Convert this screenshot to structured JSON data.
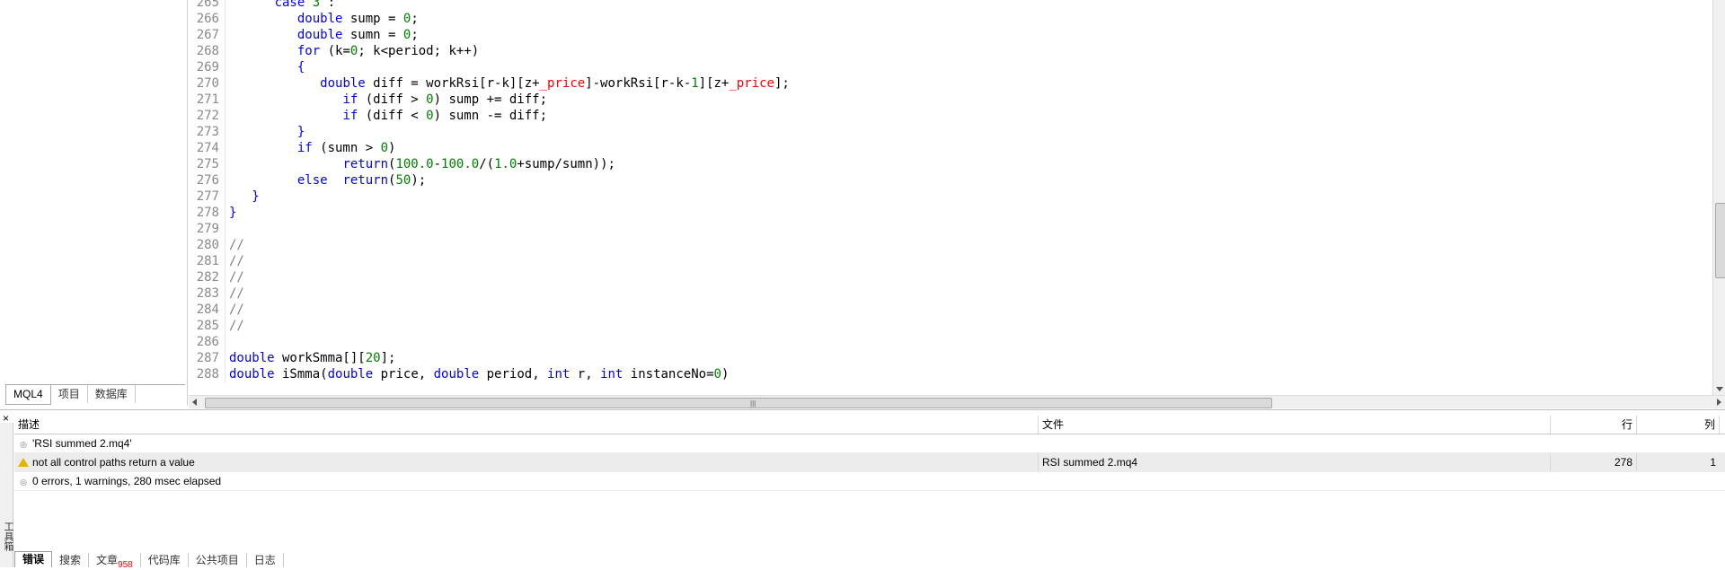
{
  "navigator": {
    "tabs": [
      "MQL4",
      "项目",
      "数据库"
    ]
  },
  "editor": {
    "lines": [
      {
        "n": "265",
        "parts": [
          [
            "ct",
            "      "
          ],
          [
            "kw",
            "case"
          ],
          [
            "ct",
            " "
          ],
          [
            "num",
            "3"
          ],
          [
            "ct",
            " :"
          ]
        ]
      },
      {
        "n": "266",
        "parts": [
          [
            "ct",
            "         "
          ],
          [
            "tp",
            "double"
          ],
          [
            "ct",
            " sump = "
          ],
          [
            "num",
            "0"
          ],
          [
            "ct",
            ";"
          ]
        ]
      },
      {
        "n": "267",
        "parts": [
          [
            "ct",
            "         "
          ],
          [
            "tp",
            "double"
          ],
          [
            "ct",
            " sumn = "
          ],
          [
            "num",
            "0"
          ],
          [
            "ct",
            ";"
          ]
        ]
      },
      {
        "n": "268",
        "parts": [
          [
            "ct",
            "         "
          ],
          [
            "kw",
            "for"
          ],
          [
            "ct",
            " (k="
          ],
          [
            "num",
            "0"
          ],
          [
            "ct",
            "; k<period; k++)"
          ]
        ]
      },
      {
        "n": "269",
        "parts": [
          [
            "ct",
            "         "
          ],
          [
            "kw",
            "{"
          ]
        ]
      },
      {
        "n": "270",
        "parts": [
          [
            "ct",
            "            "
          ],
          [
            "tp",
            "double"
          ],
          [
            "ct",
            " diff = workRsi[r-k][z+"
          ],
          [
            "var",
            "_price"
          ],
          [
            "ct",
            "]-workRsi[r-k-"
          ],
          [
            "num",
            "1"
          ],
          [
            "ct",
            "][z+"
          ],
          [
            "var",
            "_price"
          ],
          [
            "ct",
            "];"
          ]
        ]
      },
      {
        "n": "271",
        "parts": [
          [
            "ct",
            "               "
          ],
          [
            "kw",
            "if"
          ],
          [
            "ct",
            " (diff > "
          ],
          [
            "num",
            "0"
          ],
          [
            "ct",
            ") sump += diff;"
          ]
        ]
      },
      {
        "n": "272",
        "parts": [
          [
            "ct",
            "               "
          ],
          [
            "kw",
            "if"
          ],
          [
            "ct",
            " (diff < "
          ],
          [
            "num",
            "0"
          ],
          [
            "ct",
            ") sumn -= diff;"
          ]
        ]
      },
      {
        "n": "273",
        "parts": [
          [
            "ct",
            "         "
          ],
          [
            "kw",
            "}"
          ]
        ]
      },
      {
        "n": "274",
        "parts": [
          [
            "ct",
            "         "
          ],
          [
            "kw",
            "if"
          ],
          [
            "ct",
            " (sumn > "
          ],
          [
            "num",
            "0"
          ],
          [
            "ct",
            ")"
          ]
        ]
      },
      {
        "n": "275",
        "parts": [
          [
            "ct",
            "               "
          ],
          [
            "kw",
            "return"
          ],
          [
            "ct",
            "("
          ],
          [
            "num",
            "100.0"
          ],
          [
            "ct",
            "-"
          ],
          [
            "num",
            "100.0"
          ],
          [
            "ct",
            "/("
          ],
          [
            "num",
            "1.0"
          ],
          [
            "ct",
            "+sump/sumn));"
          ]
        ]
      },
      {
        "n": "276",
        "parts": [
          [
            "ct",
            "         "
          ],
          [
            "kw",
            "else"
          ],
          [
            "ct",
            "  "
          ],
          [
            "kw",
            "return"
          ],
          [
            "ct",
            "("
          ],
          [
            "num",
            "50"
          ],
          [
            "ct",
            ");"
          ]
        ]
      },
      {
        "n": "277",
        "parts": [
          [
            "ct",
            "   "
          ],
          [
            "kw",
            "}"
          ]
        ]
      },
      {
        "n": "278",
        "parts": [
          [
            "kw",
            "}"
          ]
        ]
      },
      {
        "n": "279",
        "parts": []
      },
      {
        "n": "280",
        "parts": [
          [
            "cm",
            "//"
          ]
        ]
      },
      {
        "n": "281",
        "parts": [
          [
            "cm",
            "//"
          ]
        ]
      },
      {
        "n": "282",
        "parts": [
          [
            "cm",
            "//"
          ]
        ]
      },
      {
        "n": "283",
        "parts": [
          [
            "cm",
            "//"
          ]
        ]
      },
      {
        "n": "284",
        "parts": [
          [
            "cm",
            "//"
          ]
        ]
      },
      {
        "n": "285",
        "parts": [
          [
            "cm",
            "//"
          ]
        ]
      },
      {
        "n": "286",
        "parts": []
      },
      {
        "n": "287",
        "parts": [
          [
            "tp",
            "double"
          ],
          [
            "ct",
            " workSmma[]["
          ],
          [
            "num",
            "20"
          ],
          [
            "ct",
            "];"
          ]
        ]
      },
      {
        "n": "288",
        "parts": [
          [
            "tp",
            "double"
          ],
          [
            "ct",
            " iSmma("
          ],
          [
            "tp",
            "double"
          ],
          [
            "ct",
            " price, "
          ],
          [
            "tp",
            "double"
          ],
          [
            "ct",
            " period, "
          ],
          [
            "tp",
            "int"
          ],
          [
            "ct",
            " r, "
          ],
          [
            "tp",
            "int"
          ],
          [
            "ct",
            " instanceNo="
          ],
          [
            "num",
            "0"
          ],
          [
            "ct",
            ")"
          ]
        ]
      }
    ]
  },
  "toolbox": {
    "close_glyph": "×",
    "side_label": "工具箱",
    "columns": {
      "desc": "描述",
      "file": "文件",
      "line": "行",
      "col": "列"
    },
    "rows": [
      {
        "icon": "info",
        "desc": "'RSI summed 2.mq4'",
        "file": "",
        "line": "",
        "col": "",
        "selected": false
      },
      {
        "icon": "warning",
        "desc": "not all control paths return a value",
        "file": "RSI summed 2.mq4",
        "line": "278",
        "col": "1",
        "selected": true
      },
      {
        "icon": "info",
        "desc": "0 errors, 1 warnings, 280 msec elapsed",
        "file": "",
        "line": "",
        "col": "",
        "selected": false
      }
    ],
    "tabs": [
      {
        "label": "错误",
        "badge": ""
      },
      {
        "label": "搜索",
        "badge": ""
      },
      {
        "label": "文章",
        "badge": "958"
      },
      {
        "label": "代码库",
        "badge": ""
      },
      {
        "label": "公共项目",
        "badge": ""
      },
      {
        "label": "日志",
        "badge": ""
      }
    ],
    "active_tab": 0
  },
  "colors": {
    "keyword": "#0000ff",
    "number": "#008000",
    "variable": "#ff0000",
    "comment": "#808080",
    "warning": "#e3b400"
  }
}
